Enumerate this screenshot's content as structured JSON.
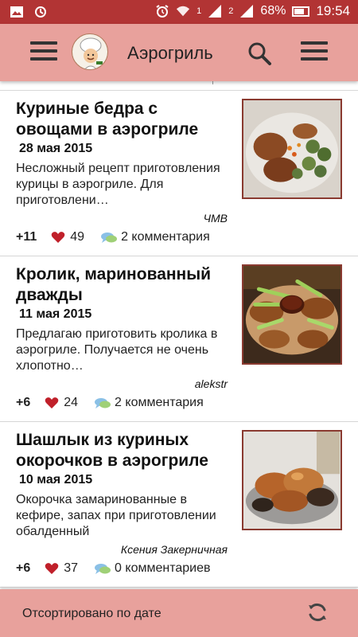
{
  "status_bar": {
    "battery_percent": "68%",
    "sim_slot_1": "1",
    "sim_slot_2": "2",
    "time": "19:54",
    "icons": [
      "gallery-icon",
      "sync-icon",
      "alarm-icon",
      "wifi-icon",
      "signal-icon",
      "signal-icon",
      "battery-icon"
    ]
  },
  "toolbar": {
    "title": "Аэрогриль",
    "menu_icon": "hamburger-menu-icon",
    "logo": "chef-logo-icon",
    "search_icon": "search-icon",
    "overflow_icon": "overflow-menu-icon"
  },
  "recipes": [
    {
      "title": "Куриные бедра с овощами в аэрогриле",
      "date": "28 мая 2015",
      "excerpt": "Несложный рецепт приготовления курицы в аэрогриле. Для приготовлени…",
      "author": "ЧМВ",
      "rating": "+11",
      "likes": "49",
      "comments": "2 комментария",
      "image": "chicken-thighs-vegetables-photo"
    },
    {
      "title": "Кролик, маринованный дважды",
      "date": "11 мая 2015",
      "excerpt": "Предлагаю приготовить кролика в аэрогриле. Получается не очень хлопотно…",
      "author": "alekstr",
      "rating": "+6",
      "likes": "24",
      "comments": "2 комментария",
      "image": "marinated-rabbit-photo"
    },
    {
      "title": "Шашлык из куриных окорочков в аэрогриле",
      "date": "10 мая 2015",
      "excerpt": "Окорочка замаринованные в кефире, запах при приготовлении обалденный",
      "author": "Ксения Закерничная",
      "rating": "+6",
      "likes": "37",
      "comments": "0 комментариев",
      "image": "chicken-leg-kebab-photo"
    }
  ],
  "bottom_bar": {
    "sort_label": "Отсортировано по дате",
    "refresh_icon": "refresh-icon"
  },
  "colors": {
    "status_bar": "#b23434",
    "toolbar": "#e8a19c",
    "heart": "#c0202a",
    "thumb_border": "#8a3a30"
  }
}
